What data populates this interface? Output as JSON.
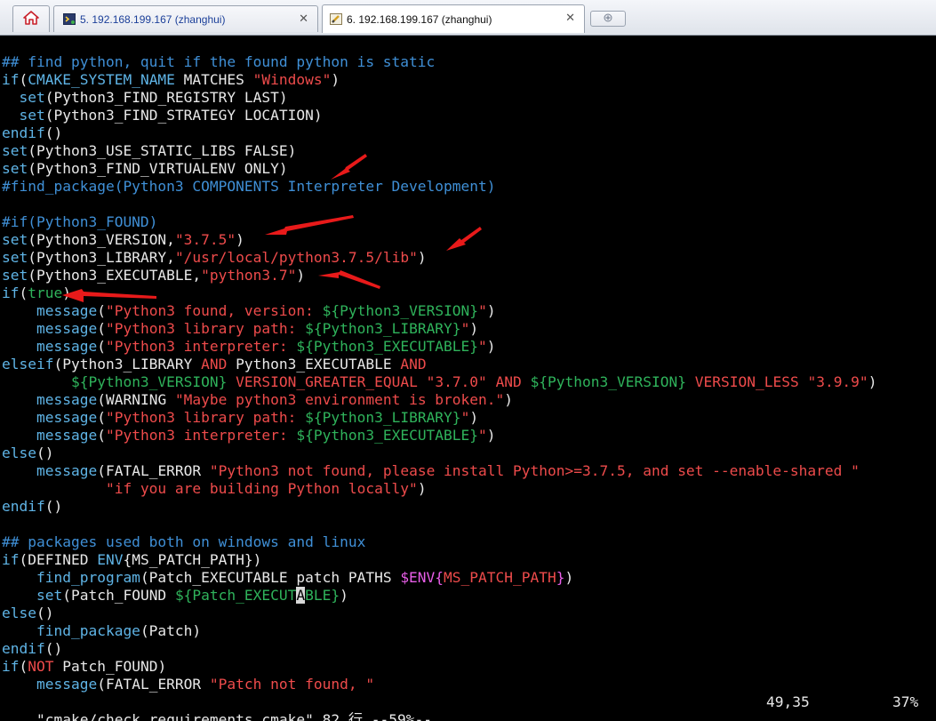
{
  "tabs": [
    {
      "label": "5. 192.168.199.167 (zhanghui)",
      "close": "✕",
      "active": false
    },
    {
      "label": "6. 192.168.199.167 (zhanghui)",
      "close": "✕",
      "active": true
    }
  ],
  "home_tab": {
    "icon": "home-icon"
  },
  "new_tab": {
    "icon": "new-tab-icon"
  },
  "colors": {
    "comment": "#3f8fd6",
    "keyword": "#5fb4e6",
    "string": "#ee4b4b",
    "variable": "#2fb35b",
    "normal": "#e8e8e8",
    "arrow": "#e81a1a"
  },
  "code": [
    [
      [
        "com",
        "## find python, quit if the found python is static"
      ]
    ],
    [
      [
        "kw",
        "if"
      ],
      [
        "nrm",
        "("
      ],
      [
        "kw",
        "CMAKE_SYSTEM_NAME"
      ],
      [
        "nrm",
        " MATCHES "
      ],
      [
        "str",
        "\"Windows\""
      ],
      [
        "nrm",
        ")"
      ]
    ],
    [
      [
        "nrm",
        "  "
      ],
      [
        "kw",
        "set"
      ],
      [
        "nrm",
        "(Python3_FIND_REGISTRY LAST)"
      ]
    ],
    [
      [
        "nrm",
        "  "
      ],
      [
        "kw",
        "set"
      ],
      [
        "nrm",
        "(Python3_FIND_STRATEGY LOCATION)"
      ]
    ],
    [
      [
        "kw",
        "endif"
      ],
      [
        "nrm",
        "()"
      ]
    ],
    [
      [
        "kw",
        "set"
      ],
      [
        "nrm",
        "(Python3_USE_STATIC_LIBS FALSE)"
      ]
    ],
    [
      [
        "kw",
        "set"
      ],
      [
        "nrm",
        "(Python3_FIND_VIRTUALENV ONLY)"
      ]
    ],
    [
      [
        "com",
        "#find_package(Python3 COMPONENTS Interpreter Development)"
      ]
    ],
    [
      [
        "nrm",
        ""
      ]
    ],
    [
      [
        "com",
        "#if(Python3_FOUND)"
      ]
    ],
    [
      [
        "kw",
        "set"
      ],
      [
        "nrm",
        "(Python3_VERSION,"
      ],
      [
        "str",
        "\"3.7.5\""
      ],
      [
        "nrm",
        ")"
      ]
    ],
    [
      [
        "kw",
        "set"
      ],
      [
        "nrm",
        "(Python3_LIBRARY,"
      ],
      [
        "str",
        "\"/usr/local/python3.7.5/lib\""
      ],
      [
        "nrm",
        ")"
      ]
    ],
    [
      [
        "kw",
        "set"
      ],
      [
        "nrm",
        "(Python3_EXECUTABLE,"
      ],
      [
        "str",
        "\"python3.7\""
      ],
      [
        "nrm",
        ")"
      ]
    ],
    [
      [
        "kw",
        "if"
      ],
      [
        "nrm",
        "("
      ],
      [
        "var",
        "true"
      ],
      [
        "nrm",
        ")"
      ]
    ],
    [
      [
        "nrm",
        "    "
      ],
      [
        "kw",
        "message"
      ],
      [
        "nrm",
        "("
      ],
      [
        "str",
        "\"Python3 found, version: "
      ],
      [
        "var",
        "${Python3_VERSION}"
      ],
      [
        "str",
        "\""
      ],
      [
        "nrm",
        ")"
      ]
    ],
    [
      [
        "nrm",
        "    "
      ],
      [
        "kw",
        "message"
      ],
      [
        "nrm",
        "("
      ],
      [
        "str",
        "\"Python3 library path: "
      ],
      [
        "var",
        "${Python3_LIBRARY}"
      ],
      [
        "str",
        "\""
      ],
      [
        "nrm",
        ")"
      ]
    ],
    [
      [
        "nrm",
        "    "
      ],
      [
        "kw",
        "message"
      ],
      [
        "nrm",
        "("
      ],
      [
        "str",
        "\"Python3 interpreter: "
      ],
      [
        "var",
        "${Python3_EXECUTABLE}"
      ],
      [
        "str",
        "\""
      ],
      [
        "nrm",
        ")"
      ]
    ],
    [
      [
        "kw",
        "elseif"
      ],
      [
        "nrm",
        "(Python3_LIBRARY "
      ],
      [
        "str",
        "AND"
      ],
      [
        "nrm",
        " Python3_EXECUTABLE "
      ],
      [
        "str",
        "AND"
      ]
    ],
    [
      [
        "nrm",
        "        "
      ],
      [
        "var",
        "${Python3_VERSION}"
      ],
      [
        "nrm",
        " "
      ],
      [
        "str",
        "VERSION_GREATER_EQUAL"
      ],
      [
        "nrm",
        " "
      ],
      [
        "str",
        "\"3.7.0\""
      ],
      [
        "nrm",
        " "
      ],
      [
        "str",
        "AND"
      ],
      [
        "nrm",
        " "
      ],
      [
        "var",
        "${Python3_VERSION}"
      ],
      [
        "nrm",
        " "
      ],
      [
        "str",
        "VERSION_LESS"
      ],
      [
        "nrm",
        " "
      ],
      [
        "str",
        "\"3.9.9\""
      ],
      [
        "nrm",
        ")"
      ]
    ],
    [
      [
        "nrm",
        "    "
      ],
      [
        "kw",
        "message"
      ],
      [
        "nrm",
        "(WARNING "
      ],
      [
        "str",
        "\"Maybe python3 environment is broken.\""
      ],
      [
        "nrm",
        ")"
      ]
    ],
    [
      [
        "nrm",
        "    "
      ],
      [
        "kw",
        "message"
      ],
      [
        "nrm",
        "("
      ],
      [
        "str",
        "\"Python3 library path: "
      ],
      [
        "var",
        "${Python3_LIBRARY}"
      ],
      [
        "str",
        "\""
      ],
      [
        "nrm",
        ")"
      ]
    ],
    [
      [
        "nrm",
        "    "
      ],
      [
        "kw",
        "message"
      ],
      [
        "nrm",
        "("
      ],
      [
        "str",
        "\"Python3 interpreter: "
      ],
      [
        "var",
        "${Python3_EXECUTABLE}"
      ],
      [
        "str",
        "\""
      ],
      [
        "nrm",
        ")"
      ]
    ],
    [
      [
        "kw",
        "else"
      ],
      [
        "nrm",
        "()"
      ]
    ],
    [
      [
        "nrm",
        "    "
      ],
      [
        "kw",
        "message"
      ],
      [
        "nrm",
        "(FATAL_ERROR "
      ],
      [
        "str",
        "\"Python3 not found, please install Python>=3.7.5, and set --enable-shared \""
      ]
    ],
    [
      [
        "nrm",
        "            "
      ],
      [
        "str",
        "\"if you are building Python locally\""
      ],
      [
        "nrm",
        ")"
      ]
    ],
    [
      [
        "kw",
        "endif"
      ],
      [
        "nrm",
        "()"
      ]
    ],
    [
      [
        "nrm",
        ""
      ]
    ],
    [
      [
        "com",
        "## packages used both on windows and linux"
      ]
    ],
    [
      [
        "kw",
        "if"
      ],
      [
        "nrm",
        "(DEFINED "
      ],
      [
        "kw",
        "ENV"
      ],
      [
        "nrm",
        "{MS_PATCH_PATH})"
      ]
    ],
    [
      [
        "nrm",
        "    "
      ],
      [
        "kw",
        "find_program"
      ],
      [
        "nrm",
        "(Patch_EXECUTABLE patch PATHS "
      ],
      [
        "mag",
        "$ENV{"
      ],
      [
        "str",
        "MS_PATCH_PATH"
      ],
      [
        "mag",
        "}"
      ],
      [
        "nrm",
        ")"
      ]
    ],
    [
      [
        "nrm",
        "    "
      ],
      [
        "kw",
        "set"
      ],
      [
        "nrm",
        "(Patch_FOUND "
      ],
      [
        "var",
        "${Patch_EXECUT"
      ],
      [
        "cur",
        "A"
      ],
      [
        "var",
        "BLE}"
      ],
      [
        "nrm",
        ")"
      ]
    ],
    [
      [
        "kw",
        "else"
      ],
      [
        "nrm",
        "()"
      ]
    ],
    [
      [
        "nrm",
        "    "
      ],
      [
        "kw",
        "find_package"
      ],
      [
        "nrm",
        "(Patch)"
      ]
    ],
    [
      [
        "kw",
        "endif"
      ],
      [
        "nrm",
        "()"
      ]
    ],
    [
      [
        "kw",
        "if"
      ],
      [
        "nrm",
        "("
      ],
      [
        "str",
        "NOT"
      ],
      [
        "nrm",
        " Patch_FOUND)"
      ]
    ],
    [
      [
        "nrm",
        "    "
      ],
      [
        "kw",
        "message"
      ],
      [
        "nrm",
        "(FATAL_ERROR "
      ],
      [
        "str",
        "\"Patch not found, \""
      ]
    ]
  ],
  "status": {
    "file": "\"cmake/check_requirements.cmake\" 82 行 --59%--",
    "position": "49,35",
    "percent": "37%"
  }
}
